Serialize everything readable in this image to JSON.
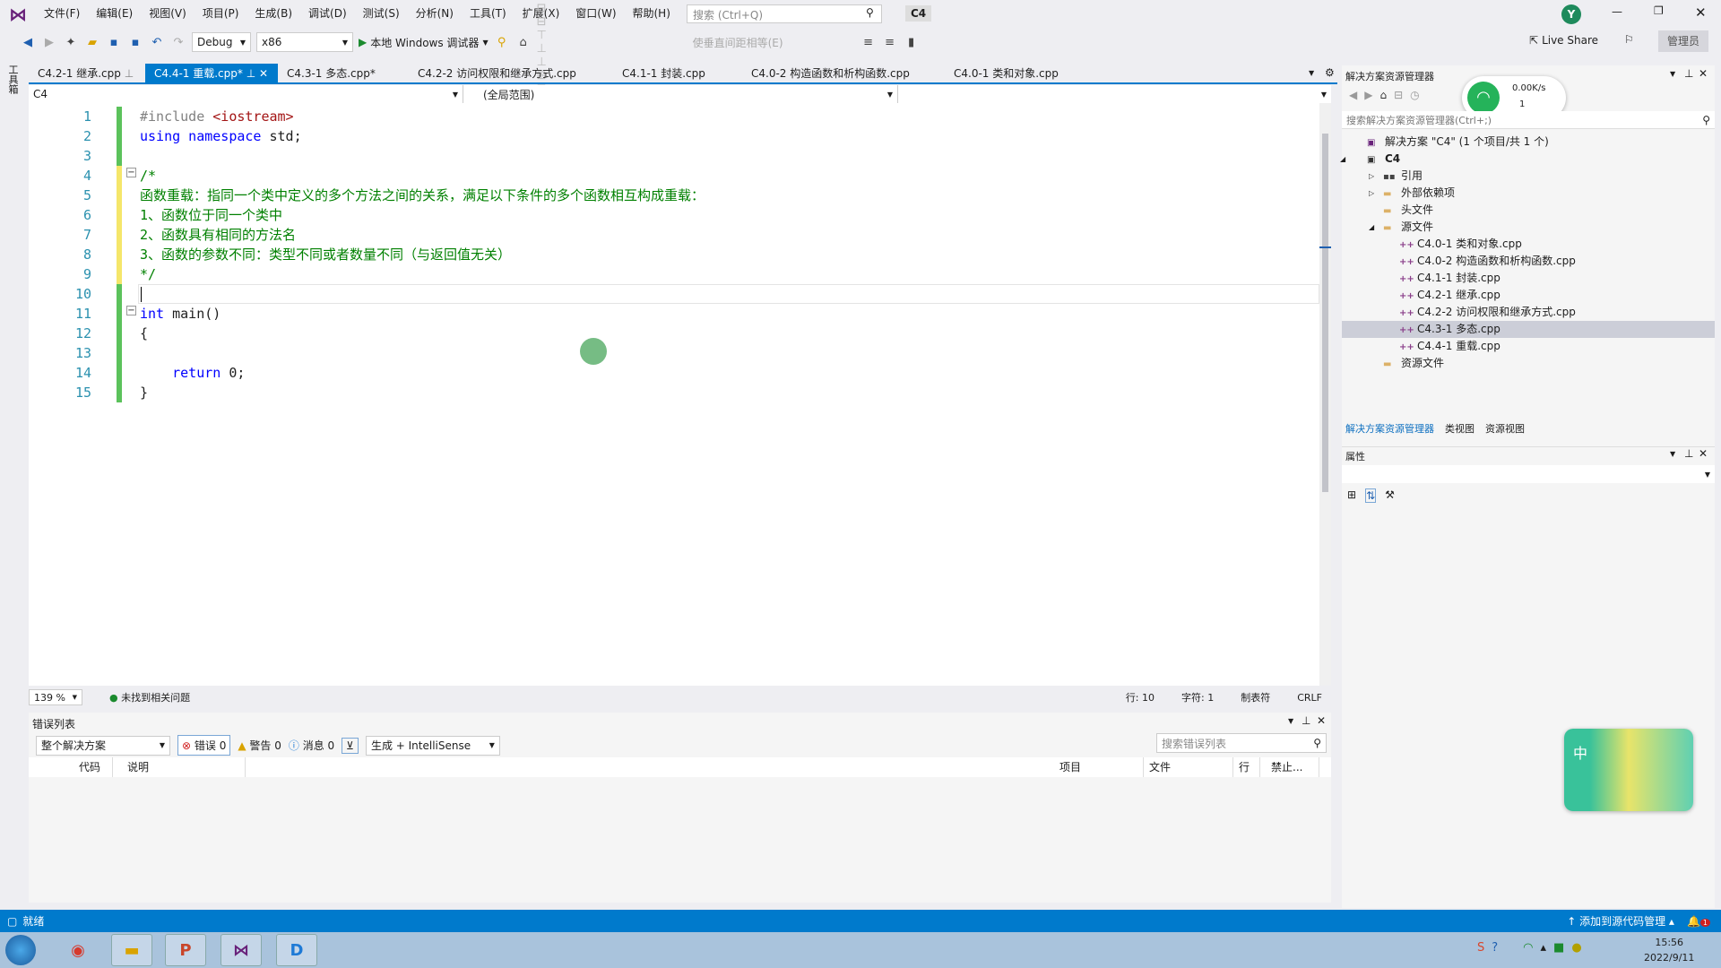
{
  "app": {
    "logo": "visual-studio-logo",
    "menus": [
      "文件(F)",
      "编辑(E)",
      "视图(V)",
      "项目(P)",
      "生成(B)",
      "调试(D)",
      "测试(S)",
      "分析(N)",
      "工具(T)",
      "扩展(X)",
      "窗口(W)",
      "帮助(H)"
    ],
    "search_placeholder": "搜索 (Ctrl+Q)",
    "solution_name": "C4",
    "user_initial": "Y",
    "live_share": "Live Share",
    "admin": "管理员"
  },
  "toolbar": {
    "config": "Debug",
    "platform": "x86",
    "run": "本地 Windows 调试器",
    "make_vertical_spacing": "使垂直间距相等(E)"
  },
  "tabs": [
    {
      "label": "C4.2-1 继承.cpp",
      "active": false
    },
    {
      "label": "C4.4-1 重载.cpp*",
      "active": true
    },
    {
      "label": "C4.3-1 多态.cpp*",
      "active": false
    },
    {
      "label": "C4.2-2 访问权限和继承方式.cpp",
      "active": false
    },
    {
      "label": "C4.1-1 封装.cpp",
      "active": false
    },
    {
      "label": "C4.0-2 构造函数和析构函数.cpp",
      "active": false
    },
    {
      "label": "C4.0-1 类和对象.cpp",
      "active": false
    }
  ],
  "nav": {
    "project": "C4",
    "scope": "(全局范围)"
  },
  "code": {
    "lines": [
      {
        "n": "1",
        "parts": [
          [
            "pp",
            "#include "
          ],
          [
            "inc",
            "<iostream>"
          ]
        ]
      },
      {
        "n": "2",
        "parts": [
          [
            "kw",
            "using namespace "
          ],
          [
            "",
            "std;"
          ]
        ]
      },
      {
        "n": "3",
        "parts": []
      },
      {
        "n": "4",
        "parts": [
          [
            "cm",
            "/*"
          ]
        ]
      },
      {
        "n": "5",
        "parts": [
          [
            "cm",
            "函数重载：指同一个类中定义的多个方法之间的关系，满足以下条件的多个函数相互构成重载："
          ]
        ]
      },
      {
        "n": "6",
        "parts": [
          [
            "cm",
            "1、函数位于同一个类中"
          ]
        ]
      },
      {
        "n": "7",
        "parts": [
          [
            "cm",
            "2、函数具有相同的方法名"
          ]
        ]
      },
      {
        "n": "8",
        "parts": [
          [
            "cm",
            "3、函数的参数不同：类型不同或者数量不同（与返回值无关）"
          ]
        ]
      },
      {
        "n": "9",
        "parts": [
          [
            "cm",
            "*/"
          ]
        ]
      },
      {
        "n": "10",
        "parts": []
      },
      {
        "n": "11",
        "parts": [
          [
            "kw",
            "int "
          ],
          [
            "",
            "main()"
          ]
        ]
      },
      {
        "n": "12",
        "parts": [
          [
            "",
            "{"
          ]
        ]
      },
      {
        "n": "13",
        "parts": []
      },
      {
        "n": "14",
        "parts": [
          [
            "",
            "    "
          ],
          [
            "kw",
            "return "
          ],
          [
            "",
            "0;"
          ]
        ]
      },
      {
        "n": "15",
        "parts": [
          [
            "",
            "}"
          ]
        ]
      }
    ]
  },
  "editor_status": {
    "zoom": "139 %",
    "issues": "未找到相关问题",
    "line": "行: 10",
    "char": "字符: 1",
    "tabs": "制表符",
    "eol": "CRLF"
  },
  "error_list": {
    "title": "错误列表",
    "scope": "整个解决方案",
    "errors": "错误 0",
    "warnings": "警告 0",
    "messages": "消息 0",
    "source": "生成 + IntelliSense",
    "search_placeholder": "搜索错误列表",
    "columns": [
      "代码",
      "说明",
      "项目",
      "文件",
      "行",
      "禁止..."
    ]
  },
  "solution_explorer": {
    "title": "解决方案资源管理器",
    "search_placeholder": "搜索解决方案资源管理器(Ctrl+;)",
    "net_speed": "0.00K/s",
    "net_count": "1",
    "items": [
      {
        "label": "解决方案 \"C4\" (1 个项目/共 1 个)",
        "level": 0,
        "icon": "solution-icon"
      },
      {
        "label": "C4",
        "level": 0,
        "icon": "project-icon",
        "expanded": true,
        "bold": true
      },
      {
        "label": "引用",
        "level": 1,
        "icon": "references-icon",
        "collapsed": true
      },
      {
        "label": "外部依赖项",
        "level": 1,
        "icon": "folder-icon",
        "collapsed": true
      },
      {
        "label": "头文件",
        "level": 1,
        "icon": "folder-icon"
      },
      {
        "label": "源文件",
        "level": 1,
        "icon": "folder-icon",
        "expanded": true
      },
      {
        "label": "C4.0-1 类和对象.cpp",
        "level": 2,
        "icon": "cpp-file-icon"
      },
      {
        "label": "C4.0-2 构造函数和析构函数.cpp",
        "level": 2,
        "icon": "cpp-file-icon"
      },
      {
        "label": "C4.1-1 封装.cpp",
        "level": 2,
        "icon": "cpp-file-icon"
      },
      {
        "label": "C4.2-1 继承.cpp",
        "level": 2,
        "icon": "cpp-file-icon"
      },
      {
        "label": "C4.2-2 访问权限和继承方式.cpp",
        "level": 2,
        "icon": "cpp-file-icon"
      },
      {
        "label": "C4.3-1 多态.cpp",
        "level": 2,
        "icon": "cpp-file-icon",
        "selected": true
      },
      {
        "label": "C4.4-1 重载.cpp",
        "level": 2,
        "icon": "cpp-file-icon"
      },
      {
        "label": "资源文件",
        "level": 1,
        "icon": "folder-icon"
      }
    ],
    "bottom_tabs": [
      "解决方案资源管理器",
      "类视图",
      "资源视图"
    ]
  },
  "properties": {
    "title": "属性"
  },
  "toolbox": "工具箱",
  "statusbar": {
    "text": "就绪",
    "source_control": "添加到源代码管理",
    "notifications": "1"
  },
  "taskbar": {
    "time": "15:56",
    "date": "2022/9/11",
    "apps": [
      "chrome-icon",
      "explorer-icon",
      "powerpoint-icon",
      "visual-studio-icon",
      "dingtalk-icon"
    ]
  },
  "ime": {
    "label": "中"
  },
  "colors": {
    "accent": "#007acc",
    "comment": "#008000",
    "keyword": "#0000ff",
    "linenumber": "#2b91af"
  }
}
